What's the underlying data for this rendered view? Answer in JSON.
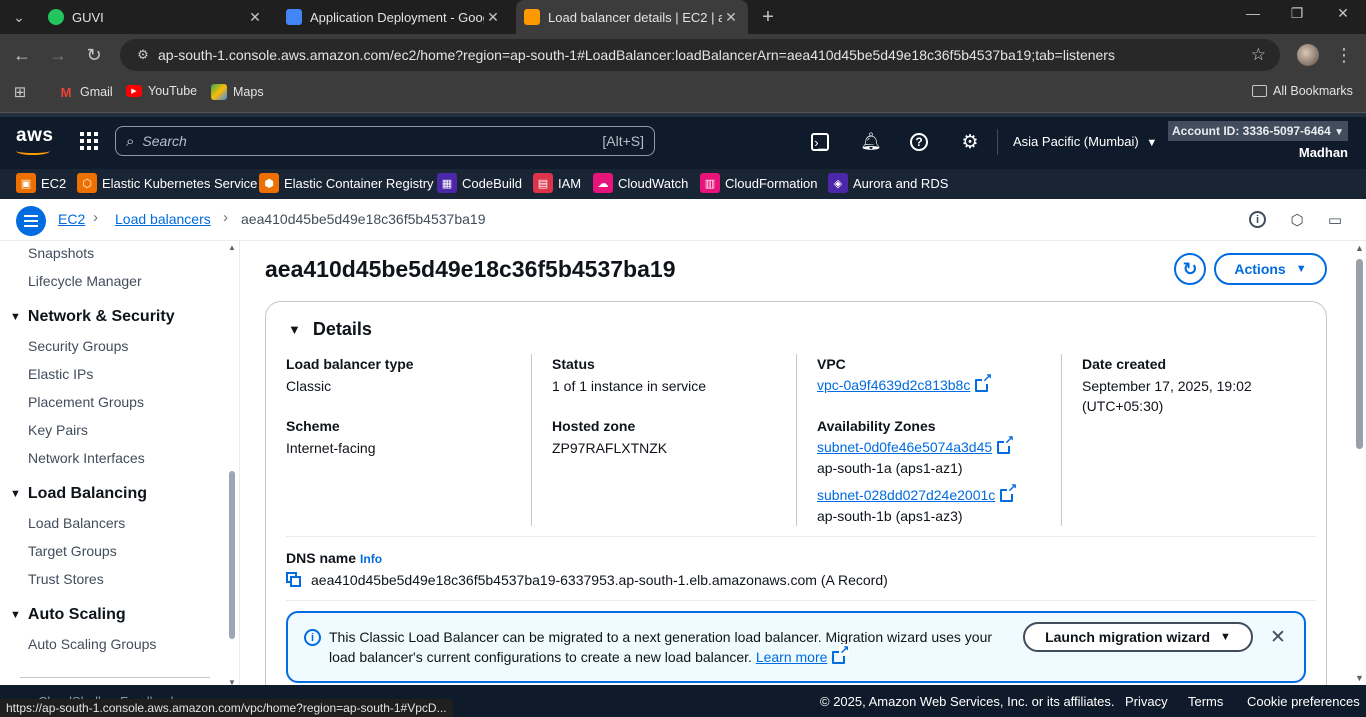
{
  "browser": {
    "tabs": [
      {
        "title": "GUVI",
        "favicon_color": "#22c55e",
        "active": false
      },
      {
        "title": "Application Deployment - Goog",
        "favicon_color": "#4285f4",
        "active": false
      },
      {
        "title": "Load balancer details | EC2 | ap",
        "favicon_color": "#ff9900",
        "active": true
      }
    ],
    "url": "ap-south-1.console.aws.amazon.com/ec2/home?region=ap-south-1#LoadBalancer:loadBalancerArn=aea410d45be5d49e18c36f5b4537ba19;tab=listeners",
    "bookmarks": [
      {
        "label": "Gmail",
        "icon": "gmail-icon"
      },
      {
        "label": "YouTube",
        "icon": "youtube-icon"
      },
      {
        "label": "Maps",
        "icon": "maps-icon"
      }
    ],
    "all_bookmarks_label": "All Bookmarks",
    "status_url": "https://ap-south-1.console.aws.amazon.com/vpc/home?region=ap-south-1#VpcD..."
  },
  "aws_nav": {
    "logo": "aws",
    "search_placeholder": "Search",
    "search_shortcut": "[Alt+S]",
    "region": "Asia Pacific (Mumbai)",
    "account": "Account ID: 3336-5097-6464",
    "user": "Madhan",
    "favorites": [
      {
        "label": "EC2",
        "color": "#ed7100"
      },
      {
        "label": "Elastic Kubernetes Service",
        "color": "#ed7100"
      },
      {
        "label": "Elastic Container Registry",
        "color": "#ed7100"
      },
      {
        "label": "CodeBuild",
        "color": "#4d27aa"
      },
      {
        "label": "IAM",
        "color": "#dd344c"
      },
      {
        "label": "CloudWatch",
        "color": "#e7157b"
      },
      {
        "label": "CloudFormation",
        "color": "#e7157b"
      },
      {
        "label": "Aurora and RDS",
        "color": "#4d27aa"
      }
    ]
  },
  "breadcrumb": {
    "items": [
      "EC2",
      "Load balancers"
    ],
    "current": "aea410d45be5d49e18c36f5b4537ba19"
  },
  "sidebar": {
    "items": [
      {
        "type": "link",
        "label": "Snapshots"
      },
      {
        "type": "link",
        "label": "Lifecycle Manager"
      },
      {
        "type": "section",
        "label": "Network & Security"
      },
      {
        "type": "link",
        "label": "Security Groups"
      },
      {
        "type": "link",
        "label": "Elastic IPs"
      },
      {
        "type": "link",
        "label": "Placement Groups"
      },
      {
        "type": "link",
        "label": "Key Pairs"
      },
      {
        "type": "link",
        "label": "Network Interfaces"
      },
      {
        "type": "section",
        "label": "Load Balancing"
      },
      {
        "type": "link",
        "label": "Load Balancers"
      },
      {
        "type": "link",
        "label": "Target Groups"
      },
      {
        "type": "link",
        "label": "Trust Stores"
      },
      {
        "type": "section",
        "label": "Auto Scaling"
      },
      {
        "type": "link",
        "label": "Auto Scaling Groups"
      }
    ]
  },
  "main": {
    "title": "aea410d45be5d49e18c36f5b4537ba19",
    "actions_label": "Actions",
    "details": {
      "heading": "Details",
      "lb_type_key": "Load balancer type",
      "lb_type_val": "Classic",
      "scheme_key": "Scheme",
      "scheme_val": "Internet-facing",
      "status_key": "Status",
      "status_val": "1 of 1 instance in service",
      "hosted_zone_key": "Hosted zone",
      "hosted_zone_val": "ZP97RAFLXTNZK",
      "vpc_key": "VPC",
      "vpc_val": "vpc-0a9f4639d2c813b8c",
      "az_key": "Availability Zones",
      "az": [
        {
          "subnet": "subnet-0d0fe46e5074a3d45",
          "zone": "ap-south-1a (aps1-az1)"
        },
        {
          "subnet": "subnet-028dd027d24e2001c",
          "zone": "ap-south-1b (aps1-az3)"
        }
      ],
      "date_key": "Date created",
      "date_val_1": "September 17, 2025, 19:02",
      "date_val_2": "(UTC+05:30)",
      "dns_key": "DNS name",
      "dns_info": "Info",
      "dns_val": "aea410d45be5d49e18c36f5b4537ba19-6337953.ap-south-1.elb.amazonaws.com (A Record)"
    },
    "flash": {
      "message_1": "This Classic Load Balancer can be migrated to a next generation load balancer. Migration wizard uses your load balancer's current configurations to create a new load balancer. ",
      "learn_more": "Learn more",
      "button": "Launch migration wizard"
    }
  },
  "footer": {
    "cloudshell": "CloudShell",
    "feedback": "Feedback",
    "copyright": "© 2025, Amazon Web Services, Inc. or its affiliates.",
    "privacy": "Privacy",
    "terms": "Terms",
    "cookies": "Cookie preferences"
  }
}
